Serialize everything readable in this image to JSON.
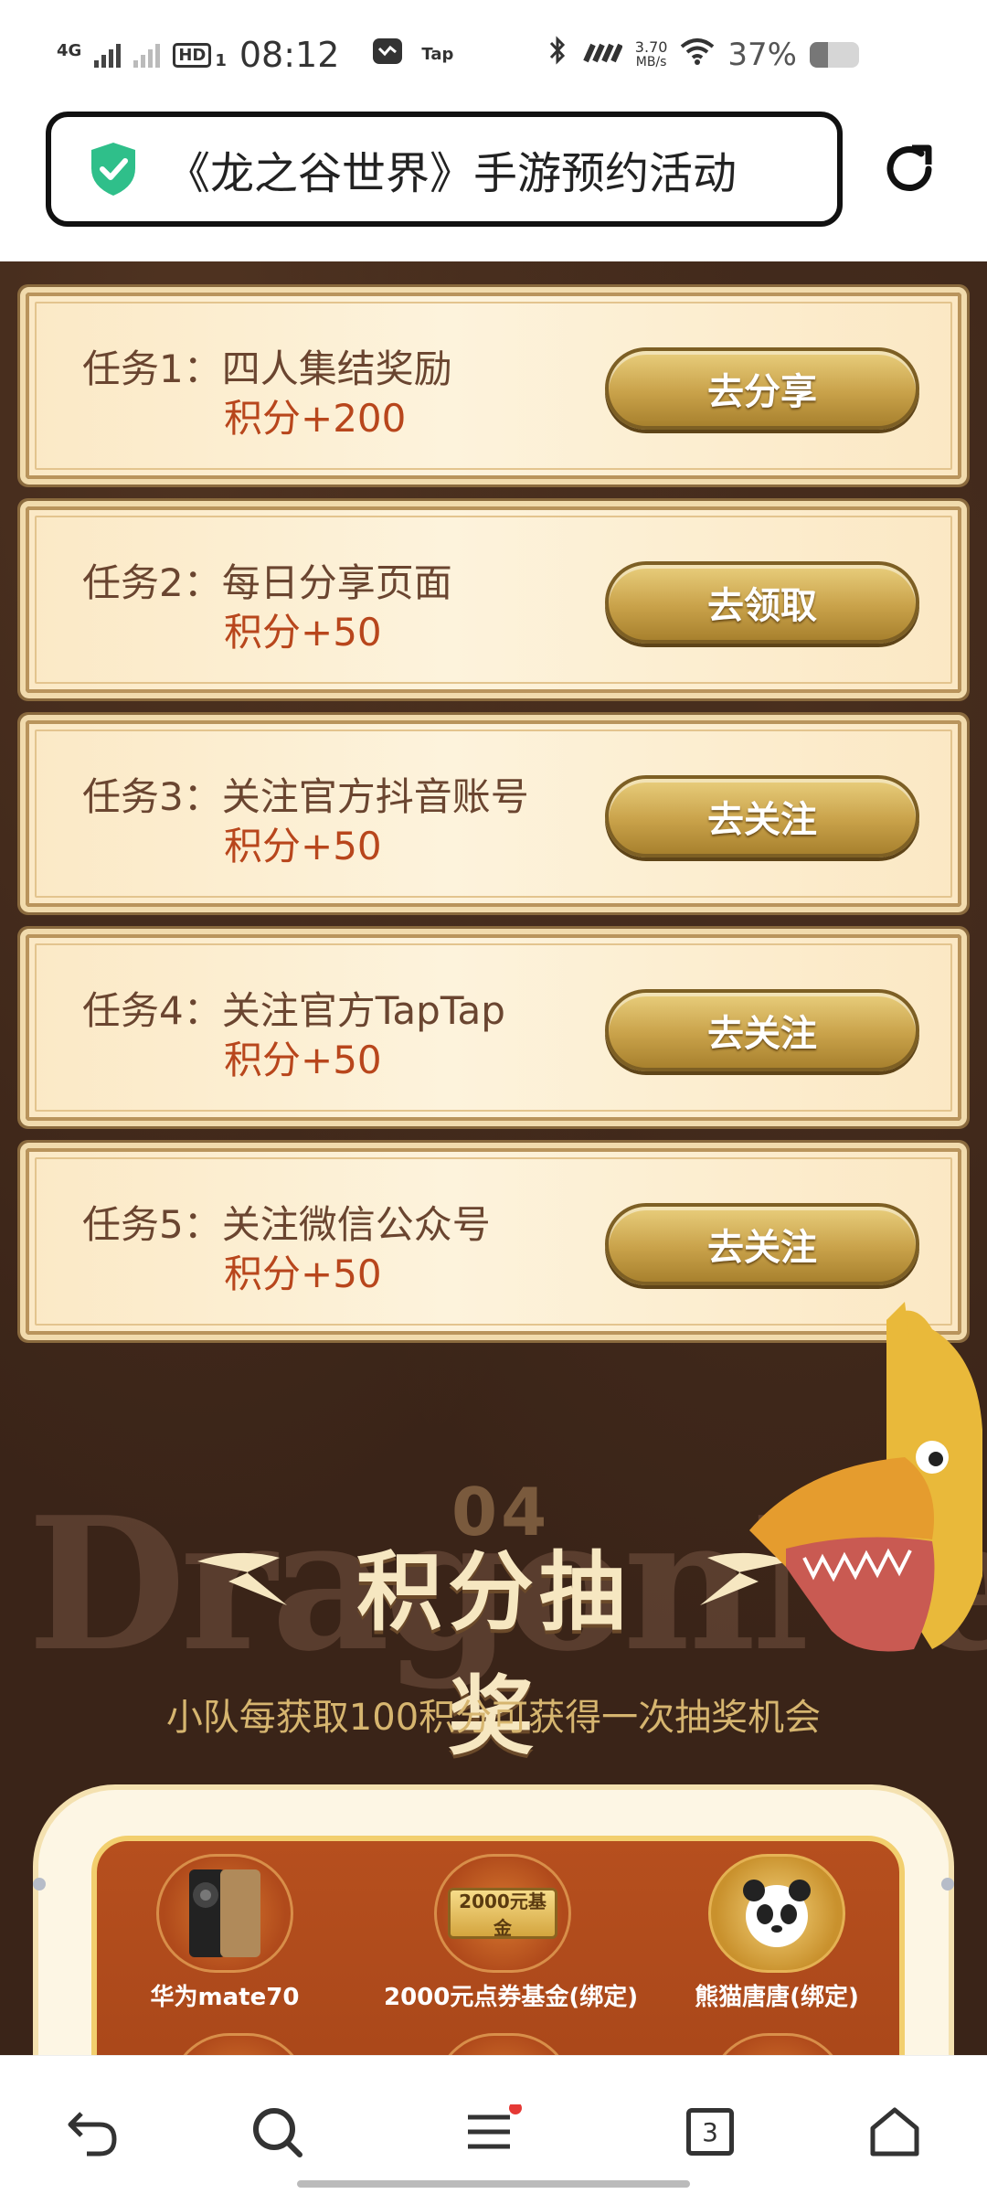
{
  "status_bar": {
    "network_type": "4G",
    "hd_label": "HD",
    "hd_sub": "1",
    "time": "08:12",
    "app_label": "Tap",
    "speed_value": "3.70",
    "speed_unit": "MB/s",
    "battery_percent": "37%",
    "battery_level": 0.37
  },
  "url_bar": {
    "title": "《龙之谷世界》手游预约活动"
  },
  "tasks": [
    {
      "title": "任务1：四人集结奖励",
      "points": "积分+200",
      "button": "去分享"
    },
    {
      "title": "任务2：每日分享页面",
      "points": "积分+50",
      "button": "去领取"
    },
    {
      "title": "任务3：关注官方抖音账号",
      "points": "积分+50",
      "button": "去关注"
    },
    {
      "title": "任务4：关注官方TapTap",
      "points": "积分+50",
      "button": "去关注"
    },
    {
      "title": "任务5：关注微信公众号",
      "points": "积分+50",
      "button": "去关注"
    }
  ],
  "lottery": {
    "section_number": "04",
    "title": "积分抽奖",
    "background_word": "DragonNest",
    "subtitle": "小队每获取100积分可获得一次抽奖机会",
    "prizes": [
      {
        "label": "华为mate70",
        "icon": "phone-icon"
      },
      {
        "label": "2000元点券基金(绑定)",
        "icon": "voucher-icon",
        "badge_text": "2000元基金"
      },
      {
        "label": "熊猫唐唐(绑定)",
        "icon": "panda-icon"
      }
    ]
  },
  "bottom_nav": {
    "tab_count": "3"
  },
  "colors": {
    "accent_points": "#b8461c",
    "task_text": "#6a4530",
    "button_gold": "#c9a24a",
    "page_bg": "#3a2418"
  }
}
